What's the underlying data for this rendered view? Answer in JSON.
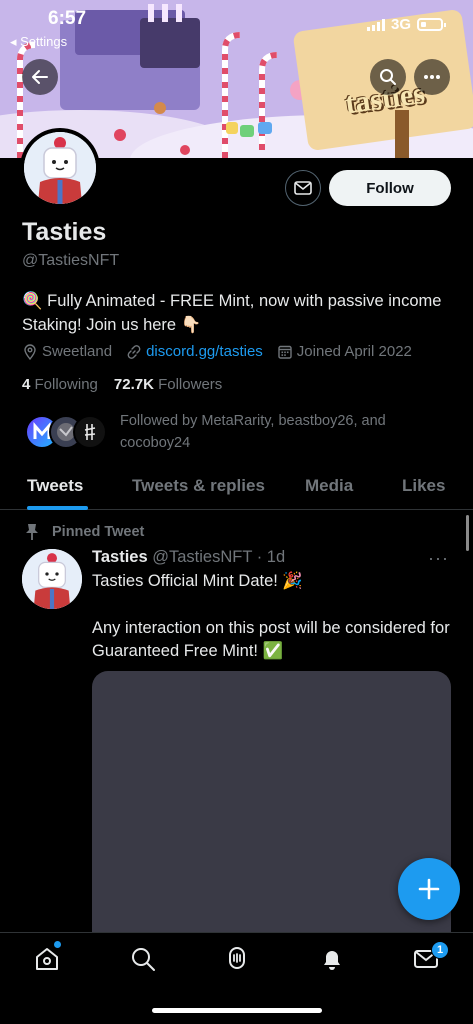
{
  "status_bar": {
    "time": "6:57",
    "back_label": "◂ Settings",
    "network": "3G"
  },
  "profile": {
    "name": "Tasties",
    "handle": "@TastiesNFT",
    "bio": "🍭 Fully Animated - FREE Mint, now with passive income Staking! Join us here 👇🏻",
    "location": "Sweetland",
    "link": "discord.gg/tasties",
    "joined": "Joined April 2022",
    "following_count": "4",
    "following_label": "Following",
    "followers_count": "72.7K",
    "followers_label": "Followers",
    "followed_by": "Followed by MetaRarity, beastboy26, and cocoboy24",
    "follow_button": "Follow",
    "banner_sign": "tasties"
  },
  "tabs": [
    {
      "label": "Tweets",
      "active": true
    },
    {
      "label": "Tweets & replies",
      "active": false
    },
    {
      "label": "Media",
      "active": false
    },
    {
      "label": "Likes",
      "active": false
    }
  ],
  "tweet": {
    "pinned_label": "Pinned Tweet",
    "author_name": "Tasties",
    "author_handle": "@TastiesNFT · 1d",
    "line1": "Tasties Official Mint Date! 🎉",
    "line2": "Any interaction on this post will be considered for Guaranteed Free Mint! ✅"
  },
  "bottom_nav": {
    "items": [
      "home-icon",
      "search-icon",
      "spaces-icon",
      "notifications-icon",
      "messages-icon"
    ],
    "messages_badge": "1"
  },
  "colors": {
    "accent": "#1d9bf0",
    "background": "#000000",
    "muted": "#71767b",
    "media_placeholder": "#3a3a46"
  }
}
